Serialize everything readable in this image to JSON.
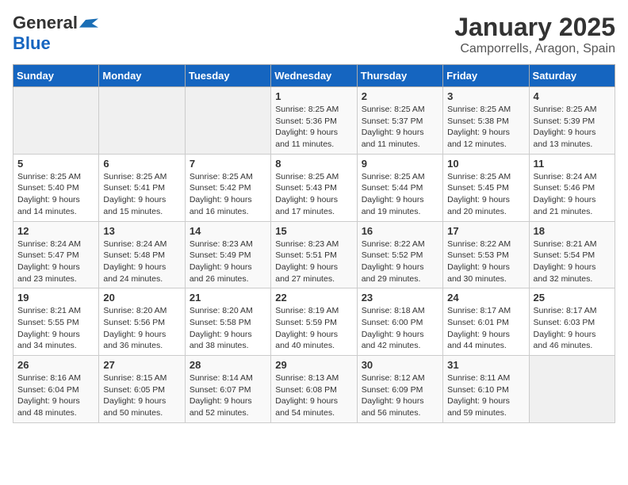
{
  "header": {
    "logo_general": "General",
    "logo_blue": "Blue",
    "month": "January 2025",
    "location": "Camporrells, Aragon, Spain"
  },
  "days_of_week": [
    "Sunday",
    "Monday",
    "Tuesday",
    "Wednesday",
    "Thursday",
    "Friday",
    "Saturday"
  ],
  "weeks": [
    [
      {
        "day": null,
        "info": null
      },
      {
        "day": null,
        "info": null
      },
      {
        "day": null,
        "info": null
      },
      {
        "day": "1",
        "info": "Sunrise: 8:25 AM\nSunset: 5:36 PM\nDaylight: 9 hours\nand 11 minutes."
      },
      {
        "day": "2",
        "info": "Sunrise: 8:25 AM\nSunset: 5:37 PM\nDaylight: 9 hours\nand 11 minutes."
      },
      {
        "day": "3",
        "info": "Sunrise: 8:25 AM\nSunset: 5:38 PM\nDaylight: 9 hours\nand 12 minutes."
      },
      {
        "day": "4",
        "info": "Sunrise: 8:25 AM\nSunset: 5:39 PM\nDaylight: 9 hours\nand 13 minutes."
      }
    ],
    [
      {
        "day": "5",
        "info": "Sunrise: 8:25 AM\nSunset: 5:40 PM\nDaylight: 9 hours\nand 14 minutes."
      },
      {
        "day": "6",
        "info": "Sunrise: 8:25 AM\nSunset: 5:41 PM\nDaylight: 9 hours\nand 15 minutes."
      },
      {
        "day": "7",
        "info": "Sunrise: 8:25 AM\nSunset: 5:42 PM\nDaylight: 9 hours\nand 16 minutes."
      },
      {
        "day": "8",
        "info": "Sunrise: 8:25 AM\nSunset: 5:43 PM\nDaylight: 9 hours\nand 17 minutes."
      },
      {
        "day": "9",
        "info": "Sunrise: 8:25 AM\nSunset: 5:44 PM\nDaylight: 9 hours\nand 19 minutes."
      },
      {
        "day": "10",
        "info": "Sunrise: 8:25 AM\nSunset: 5:45 PM\nDaylight: 9 hours\nand 20 minutes."
      },
      {
        "day": "11",
        "info": "Sunrise: 8:24 AM\nSunset: 5:46 PM\nDaylight: 9 hours\nand 21 minutes."
      }
    ],
    [
      {
        "day": "12",
        "info": "Sunrise: 8:24 AM\nSunset: 5:47 PM\nDaylight: 9 hours\nand 23 minutes."
      },
      {
        "day": "13",
        "info": "Sunrise: 8:24 AM\nSunset: 5:48 PM\nDaylight: 9 hours\nand 24 minutes."
      },
      {
        "day": "14",
        "info": "Sunrise: 8:23 AM\nSunset: 5:49 PM\nDaylight: 9 hours\nand 26 minutes."
      },
      {
        "day": "15",
        "info": "Sunrise: 8:23 AM\nSunset: 5:51 PM\nDaylight: 9 hours\nand 27 minutes."
      },
      {
        "day": "16",
        "info": "Sunrise: 8:22 AM\nSunset: 5:52 PM\nDaylight: 9 hours\nand 29 minutes."
      },
      {
        "day": "17",
        "info": "Sunrise: 8:22 AM\nSunset: 5:53 PM\nDaylight: 9 hours\nand 30 minutes."
      },
      {
        "day": "18",
        "info": "Sunrise: 8:21 AM\nSunset: 5:54 PM\nDaylight: 9 hours\nand 32 minutes."
      }
    ],
    [
      {
        "day": "19",
        "info": "Sunrise: 8:21 AM\nSunset: 5:55 PM\nDaylight: 9 hours\nand 34 minutes."
      },
      {
        "day": "20",
        "info": "Sunrise: 8:20 AM\nSunset: 5:56 PM\nDaylight: 9 hours\nand 36 minutes."
      },
      {
        "day": "21",
        "info": "Sunrise: 8:20 AM\nSunset: 5:58 PM\nDaylight: 9 hours\nand 38 minutes."
      },
      {
        "day": "22",
        "info": "Sunrise: 8:19 AM\nSunset: 5:59 PM\nDaylight: 9 hours\nand 40 minutes."
      },
      {
        "day": "23",
        "info": "Sunrise: 8:18 AM\nSunset: 6:00 PM\nDaylight: 9 hours\nand 42 minutes."
      },
      {
        "day": "24",
        "info": "Sunrise: 8:17 AM\nSunset: 6:01 PM\nDaylight: 9 hours\nand 44 minutes."
      },
      {
        "day": "25",
        "info": "Sunrise: 8:17 AM\nSunset: 6:03 PM\nDaylight: 9 hours\nand 46 minutes."
      }
    ],
    [
      {
        "day": "26",
        "info": "Sunrise: 8:16 AM\nSunset: 6:04 PM\nDaylight: 9 hours\nand 48 minutes."
      },
      {
        "day": "27",
        "info": "Sunrise: 8:15 AM\nSunset: 6:05 PM\nDaylight: 9 hours\nand 50 minutes."
      },
      {
        "day": "28",
        "info": "Sunrise: 8:14 AM\nSunset: 6:07 PM\nDaylight: 9 hours\nand 52 minutes."
      },
      {
        "day": "29",
        "info": "Sunrise: 8:13 AM\nSunset: 6:08 PM\nDaylight: 9 hours\nand 54 minutes."
      },
      {
        "day": "30",
        "info": "Sunrise: 8:12 AM\nSunset: 6:09 PM\nDaylight: 9 hours\nand 56 minutes."
      },
      {
        "day": "31",
        "info": "Sunrise: 8:11 AM\nSunset: 6:10 PM\nDaylight: 9 hours\nand 59 minutes."
      },
      {
        "day": null,
        "info": null
      }
    ]
  ]
}
